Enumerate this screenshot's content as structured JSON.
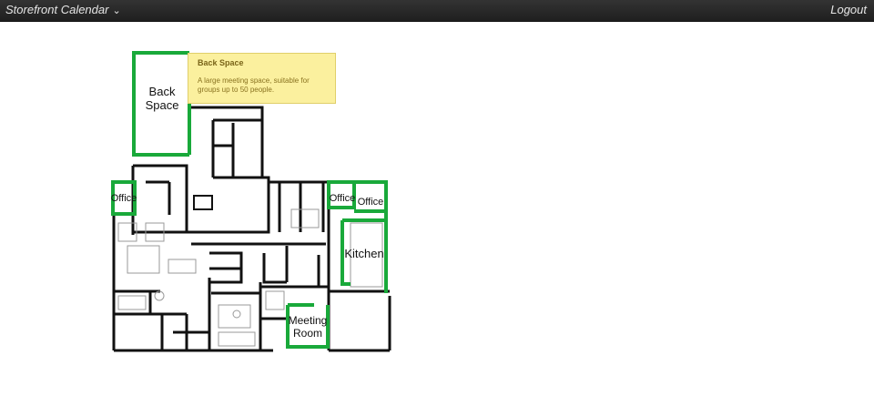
{
  "nav": {
    "brand": "Storefront Calendar",
    "logout": "Logout"
  },
  "rooms": {
    "back_space": [
      "Back",
      "Space"
    ],
    "office_left": "Office",
    "office_mid": "Office",
    "office_right": "Office",
    "kitchen": "Kitchen",
    "meeting_room": [
      "Meeting",
      "Room"
    ]
  },
  "tooltip": {
    "title": "Back Space",
    "body": "A large meeting space, suitable for groups up to 50 people."
  },
  "colors": {
    "highlight": "#19a93a",
    "wall": "#111111",
    "tooltip_bg": "#fbf09e"
  }
}
